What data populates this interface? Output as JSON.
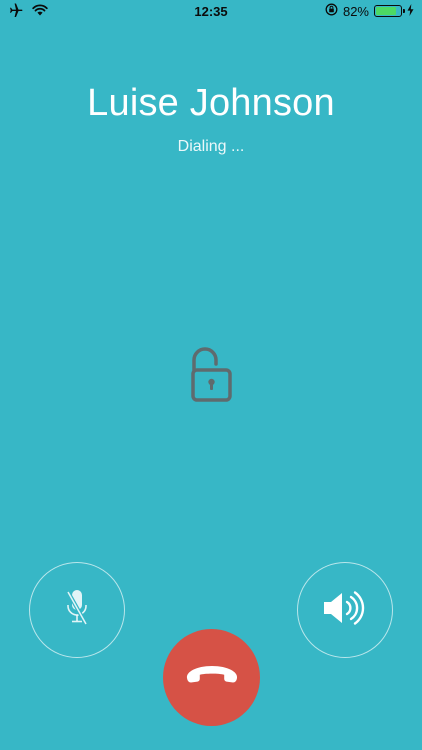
{
  "status_bar": {
    "time": "12:35",
    "battery_percent": "82%",
    "battery_level": 0.82,
    "icons": [
      "airplane-icon",
      "wifi-icon",
      "orientation-lock-icon",
      "battery-icon",
      "charging-icon"
    ]
  },
  "call": {
    "caller_name": "Luise Johnson",
    "status": "Dialing ..."
  },
  "controls": {
    "lock_icon": "unlocked-padlock-icon",
    "mute_icon": "microphone-muted-icon",
    "speaker_icon": "speaker-icon",
    "end_call_icon": "phone-hangup-icon"
  },
  "colors": {
    "background": "#37b7c6",
    "end_call": "#d65246",
    "battery": "#4cd964",
    "lock_icon": "#5f6b6e"
  }
}
